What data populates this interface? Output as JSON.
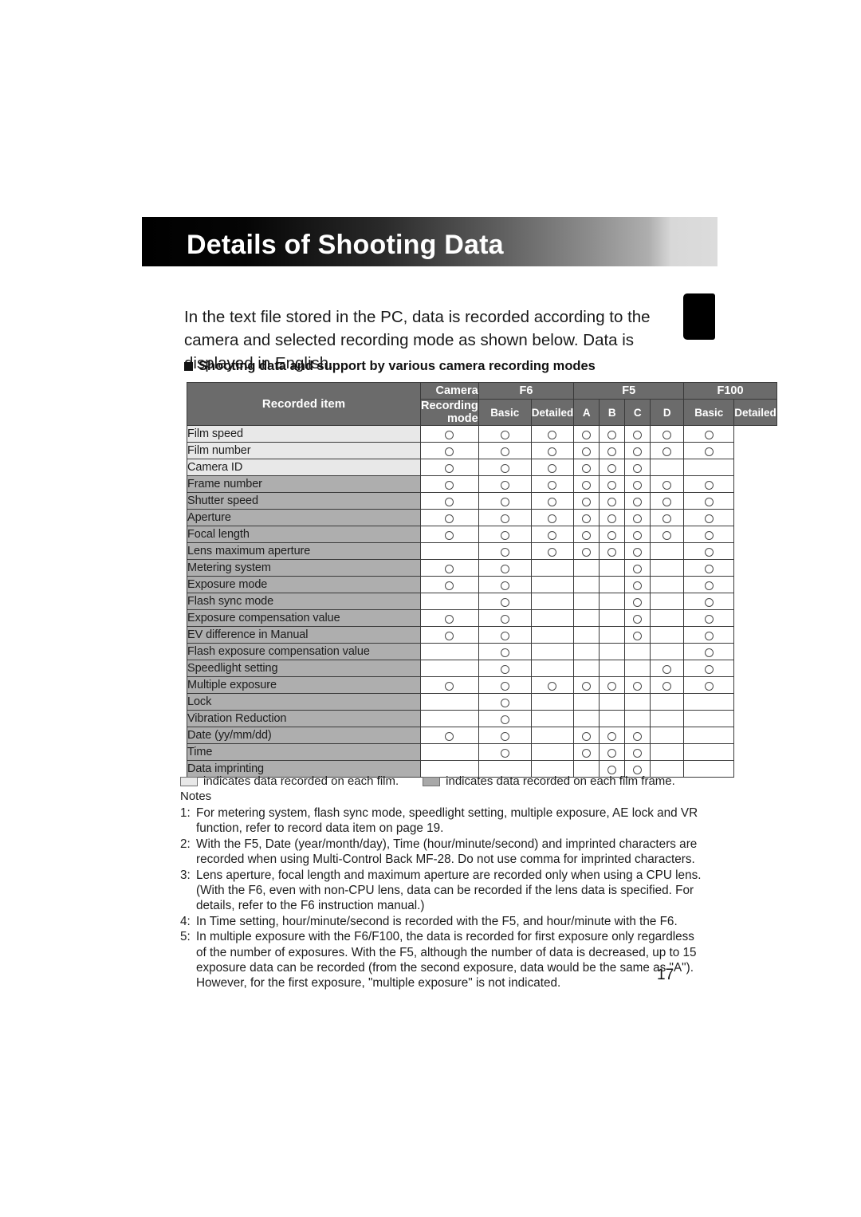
{
  "page": {
    "title": "Details of Shooting Data",
    "number": "17",
    "intro": "In the text file stored in the PC, data is recorded according to the camera and selected recording mode as shown below. Data is displayed in English.",
    "section_heading": "Shooting data and support by various camera recording modes"
  },
  "colors": {
    "header_fill": "#6b6b6b",
    "row_film": "#e8e8e8",
    "row_frame": "#aeaeae",
    "banner_dark": "#000000",
    "banner_light": "#dcdcdc"
  },
  "table": {
    "header": {
      "recorded_item": "Recorded item",
      "camera_label": "Camera",
      "recording_mode_label": "Recording mode",
      "groups": [
        {
          "name": "F6",
          "modes": [
            "Basic",
            "Detailed"
          ]
        },
        {
          "name": "F5",
          "modes": [
            "A",
            "B",
            "C",
            "D"
          ]
        },
        {
          "name": "F100",
          "modes": [
            "Basic",
            "Detailed"
          ]
        }
      ]
    },
    "columns": [
      "F6 Basic",
      "F6 Detailed",
      "F5 A",
      "F5 B",
      "F5 C",
      "F5 D",
      "F100 Basic",
      "F100 Detailed"
    ],
    "rows": [
      {
        "label": "Film speed",
        "scope": "film",
        "marks": [
          1,
          1,
          1,
          1,
          1,
          1,
          1,
          1
        ]
      },
      {
        "label": "Film number",
        "scope": "film",
        "marks": [
          1,
          1,
          1,
          1,
          1,
          1,
          1,
          1
        ]
      },
      {
        "label": "Camera ID",
        "scope": "film",
        "marks": [
          1,
          1,
          1,
          1,
          1,
          1,
          0,
          0
        ]
      },
      {
        "label": "Frame number",
        "scope": "frame",
        "marks": [
          1,
          1,
          1,
          1,
          1,
          1,
          1,
          1
        ]
      },
      {
        "label": "Shutter speed",
        "scope": "frame",
        "marks": [
          1,
          1,
          1,
          1,
          1,
          1,
          1,
          1
        ]
      },
      {
        "label": "Aperture",
        "scope": "frame",
        "marks": [
          1,
          1,
          1,
          1,
          1,
          1,
          1,
          1
        ]
      },
      {
        "label": "Focal length",
        "scope": "frame",
        "marks": [
          1,
          1,
          1,
          1,
          1,
          1,
          1,
          1
        ]
      },
      {
        "label": "Lens maximum aperture",
        "scope": "frame",
        "marks": [
          0,
          1,
          1,
          1,
          1,
          1,
          0,
          1
        ]
      },
      {
        "label": "Metering system",
        "scope": "frame",
        "marks": [
          1,
          1,
          0,
          0,
          0,
          1,
          0,
          1
        ]
      },
      {
        "label": "Exposure mode",
        "scope": "frame",
        "marks": [
          1,
          1,
          0,
          0,
          0,
          1,
          0,
          1
        ]
      },
      {
        "label": "Flash sync mode",
        "scope": "frame",
        "marks": [
          0,
          1,
          0,
          0,
          0,
          1,
          0,
          1
        ]
      },
      {
        "label": "Exposure compensation value",
        "scope": "frame",
        "marks": [
          1,
          1,
          0,
          0,
          0,
          1,
          0,
          1
        ]
      },
      {
        "label": "EV difference in Manual",
        "scope": "frame",
        "marks": [
          1,
          1,
          0,
          0,
          0,
          1,
          0,
          1
        ]
      },
      {
        "label": "Flash exposure compensation value",
        "scope": "frame",
        "marks": [
          0,
          1,
          0,
          0,
          0,
          0,
          0,
          1
        ]
      },
      {
        "label": "Speedlight setting",
        "scope": "frame",
        "marks": [
          0,
          1,
          0,
          0,
          0,
          0,
          1,
          1
        ]
      },
      {
        "label": "Multiple exposure",
        "scope": "frame",
        "marks": [
          1,
          1,
          1,
          1,
          1,
          1,
          1,
          1
        ]
      },
      {
        "label": "Lock",
        "scope": "frame",
        "marks": [
          0,
          1,
          0,
          0,
          0,
          0,
          0,
          0
        ]
      },
      {
        "label": "Vibration Reduction",
        "scope": "frame",
        "marks": [
          0,
          1,
          0,
          0,
          0,
          0,
          0,
          0
        ]
      },
      {
        "label": "Date (yy/mm/dd)",
        "scope": "frame",
        "marks": [
          1,
          1,
          0,
          1,
          1,
          1,
          0,
          0
        ]
      },
      {
        "label": "Time",
        "scope": "frame",
        "marks": [
          0,
          1,
          0,
          1,
          1,
          1,
          0,
          0
        ]
      },
      {
        "label": "Data imprinting",
        "scope": "frame",
        "marks": [
          0,
          0,
          0,
          0,
          1,
          1,
          0,
          0
        ]
      }
    ]
  },
  "legend": {
    "film_text": "indicates data recorded on each film.",
    "frame_text": "indicates data recorded on each film frame."
  },
  "notes": {
    "label": "Notes",
    "items": [
      {
        "num": "1:",
        "text": "For metering system, flash sync mode, speedlight setting, multiple exposure, AE lock and VR function, refer to record data item on page 19."
      },
      {
        "num": "2:",
        "text": "With the F5, Date (year/month/day), Time (hour/minute/second) and imprinted characters are recorded when using Multi-Control Back MF-28. Do not use comma for imprinted characters."
      },
      {
        "num": "3:",
        "text": "Lens aperture, focal length and maximum aperture are recorded only when using a CPU lens. (With the F6, even with non-CPU lens, data can be recorded if the lens data is specified. For details, refer to the F6 instruction manual.)"
      },
      {
        "num": "4:",
        "text": "In Time setting, hour/minute/second is recorded with the F5, and hour/minute with the F6."
      },
      {
        "num": "5:",
        "text": "In multiple exposure with the F6/F100, the data is recorded for first exposure only regardless of the number of exposures. With the F5, although the number of data is decreased, up to 15 exposure data can be recorded (from the second exposure, data would be the same as \"A\"). However, for the first exposure, \"multiple exposure\" is not indicated."
      }
    ]
  }
}
